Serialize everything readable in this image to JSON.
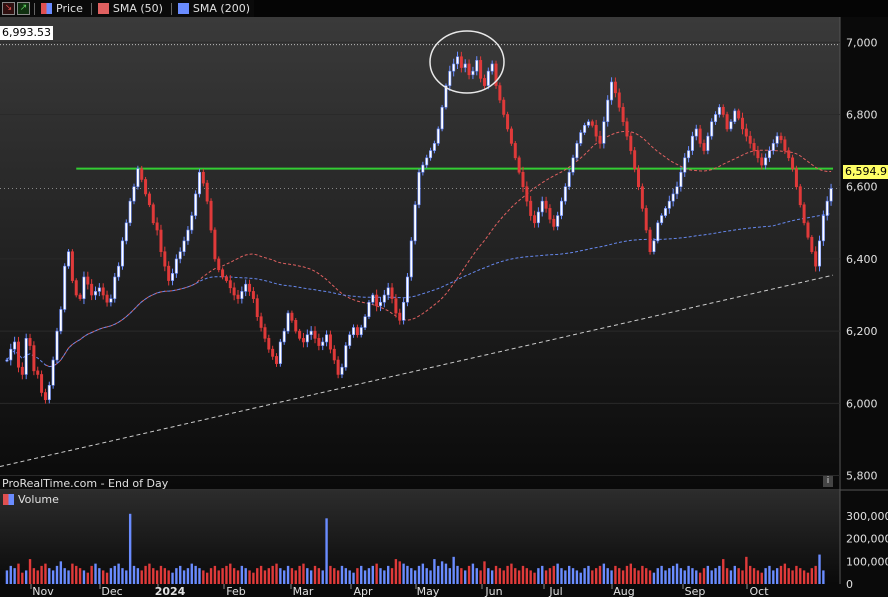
{
  "header": {
    "price_label": "Price",
    "sma50_label": "SMA (50)",
    "sma200_label": "SMA (200)",
    "colors": {
      "up": "#6a8cff",
      "down": "#e03a3a",
      "sma50": "#e06060",
      "sma200": "#6688ee",
      "level": "#33cc33",
      "last": "#ffff66"
    }
  },
  "credit": "ProRealTime.com - End of Day",
  "info_label": "i",
  "ref_level": "6,993.53",
  "last_price": "6,594.91",
  "volume_label": "Volume",
  "chart_data": {
    "type": "candlestick",
    "price_axis": {
      "ticks": [
        5800,
        6000,
        6200,
        6400,
        6600,
        6800,
        7000
      ],
      "tick_labels": [
        "5,800",
        "6,000",
        "6,200",
        "6,400",
        "6,600",
        "6,800",
        "7,000"
      ],
      "range": [
        5760,
        7070
      ]
    },
    "volume_axis": {
      "ticks": [
        0,
        100000,
        200000,
        300000
      ],
      "tick_labels": [
        "0",
        "100,000",
        "200,000",
        "300,000"
      ],
      "range": [
        0,
        340000
      ]
    },
    "months": [
      "Nov",
      "Dec",
      "2024",
      "Feb",
      "Mar",
      "Apr",
      "May",
      "Jun",
      "Jul",
      "Aug",
      "Sep",
      "Oct"
    ],
    "horizontal_level": 6650,
    "max_reference": 6993.53,
    "last_close": 6594.91,
    "trendline": {
      "from": 5825,
      "to": 6355
    },
    "closes": [
      6120,
      6150,
      6170,
      6100,
      6080,
      6180,
      6160,
      6090,
      6080,
      6030,
      6010,
      6050,
      6120,
      6200,
      6260,
      6380,
      6420,
      6340,
      6300,
      6290,
      6350,
      6330,
      6300,
      6310,
      6320,
      6300,
      6280,
      6290,
      6350,
      6380,
      6450,
      6500,
      6560,
      6600,
      6650,
      6620,
      6580,
      6550,
      6500,
      6480,
      6420,
      6380,
      6340,
      6360,
      6400,
      6420,
      6450,
      6480,
      6520,
      6580,
      6640,
      6610,
      6560,
      6480,
      6400,
      6370,
      6350,
      6340,
      6320,
      6300,
      6290,
      6310,
      6330,
      6310,
      6290,
      6240,
      6210,
      6180,
      6150,
      6130,
      6110,
      6170,
      6200,
      6250,
      6230,
      6200,
      6180,
      6170,
      6190,
      6200,
      6180,
      6160,
      6170,
      6190,
      6150,
      6120,
      6080,
      6100,
      6160,
      6190,
      6210,
      6190,
      6210,
      6240,
      6280,
      6300,
      6270,
      6280,
      6300,
      6320,
      6290,
      6250,
      6230,
      6280,
      6350,
      6450,
      6550,
      6640,
      6660,
      6680,
      6700,
      6720,
      6760,
      6820,
      6880,
      6920,
      6940,
      6960,
      6930,
      6940,
      6910,
      6920,
      6950,
      6900,
      6880,
      6920,
      6940,
      6880,
      6840,
      6800,
      6760,
      6720,
      6680,
      6640,
      6600,
      6560,
      6520,
      6500,
      6530,
      6560,
      6540,
      6510,
      6490,
      6520,
      6560,
      6600,
      6640,
      6680,
      6720,
      6750,
      6770,
      6780,
      6770,
      6740,
      6720,
      6780,
      6840,
      6890,
      6860,
      6820,
      6780,
      6740,
      6700,
      6650,
      6600,
      6540,
      6480,
      6420,
      6450,
      6500,
      6520,
      6540,
      6560,
      6580,
      6600,
      6640,
      6680,
      6700,
      6740,
      6760,
      6720,
      6700,
      6740,
      6780,
      6800,
      6820,
      6800,
      6760,
      6780,
      6810,
      6790,
      6760,
      6740,
      6720,
      6700,
      6680,
      6660,
      6680,
      6700,
      6720,
      6740,
      6730,
      6700,
      6680,
      6650,
      6600,
      6550,
      6500,
      6460,
      6420,
      6380,
      6450,
      6520,
      6560,
      6594.91
    ],
    "volumes": [
      60000,
      80000,
      70000,
      90000,
      50000,
      60000,
      110000,
      70000,
      60000,
      80000,
      90000,
      70000,
      60000,
      80000,
      100000,
      70000,
      60000,
      90000,
      80000,
      70000,
      60000,
      50000,
      80000,
      90000,
      70000,
      60000,
      50000,
      70000,
      80000,
      90000,
      70000,
      60000,
      310000,
      80000,
      70000,
      60000,
      80000,
      90000,
      70000,
      60000,
      80000,
      70000,
      60000,
      50000,
      70000,
      80000,
      60000,
      70000,
      90000,
      80000,
      70000,
      60000,
      50000,
      70000,
      80000,
      60000,
      70000,
      80000,
      90000,
      70000,
      60000,
      80000,
      70000,
      60000,
      50000,
      70000,
      80000,
      60000,
      70000,
      80000,
      90000,
      70000,
      60000,
      80000,
      70000,
      60000,
      80000,
      90000,
      70000,
      60000,
      80000,
      70000,
      60000,
      290000,
      80000,
      70000,
      60000,
      80000,
      70000,
      60000,
      50000,
      70000,
      80000,
      60000,
      70000,
      80000,
      90000,
      70000,
      60000,
      80000,
      70000,
      110000,
      100000,
      90000,
      80000,
      70000,
      60000,
      80000,
      90000,
      70000,
      60000,
      110000,
      80000,
      100000,
      90000,
      70000,
      120000,
      80000,
      70000,
      60000,
      80000,
      90000,
      70000,
      60000,
      100000,
      70000,
      60000,
      80000,
      70000,
      60000,
      80000,
      90000,
      70000,
      60000,
      80000,
      70000,
      60000,
      50000,
      70000,
      80000,
      60000,
      70000,
      80000,
      90000,
      70000,
      60000,
      80000,
      70000,
      60000,
      50000,
      70000,
      80000,
      60000,
      70000,
      80000,
      90000,
      70000,
      60000,
      80000,
      70000,
      60000,
      80000,
      90000,
      70000,
      60000,
      80000,
      70000,
      60000,
      50000,
      70000,
      80000,
      60000,
      70000,
      80000,
      90000,
      70000,
      60000,
      80000,
      70000,
      60000,
      50000,
      70000,
      80000,
      60000,
      70000,
      80000,
      110000,
      70000,
      60000,
      80000,
      70000,
      60000,
      120000,
      80000,
      70000,
      60000,
      50000,
      70000,
      80000,
      60000,
      70000,
      80000,
      90000,
      70000,
      60000,
      80000,
      70000,
      60000,
      50000,
      70000,
      80000,
      130000,
      60000
    ]
  }
}
